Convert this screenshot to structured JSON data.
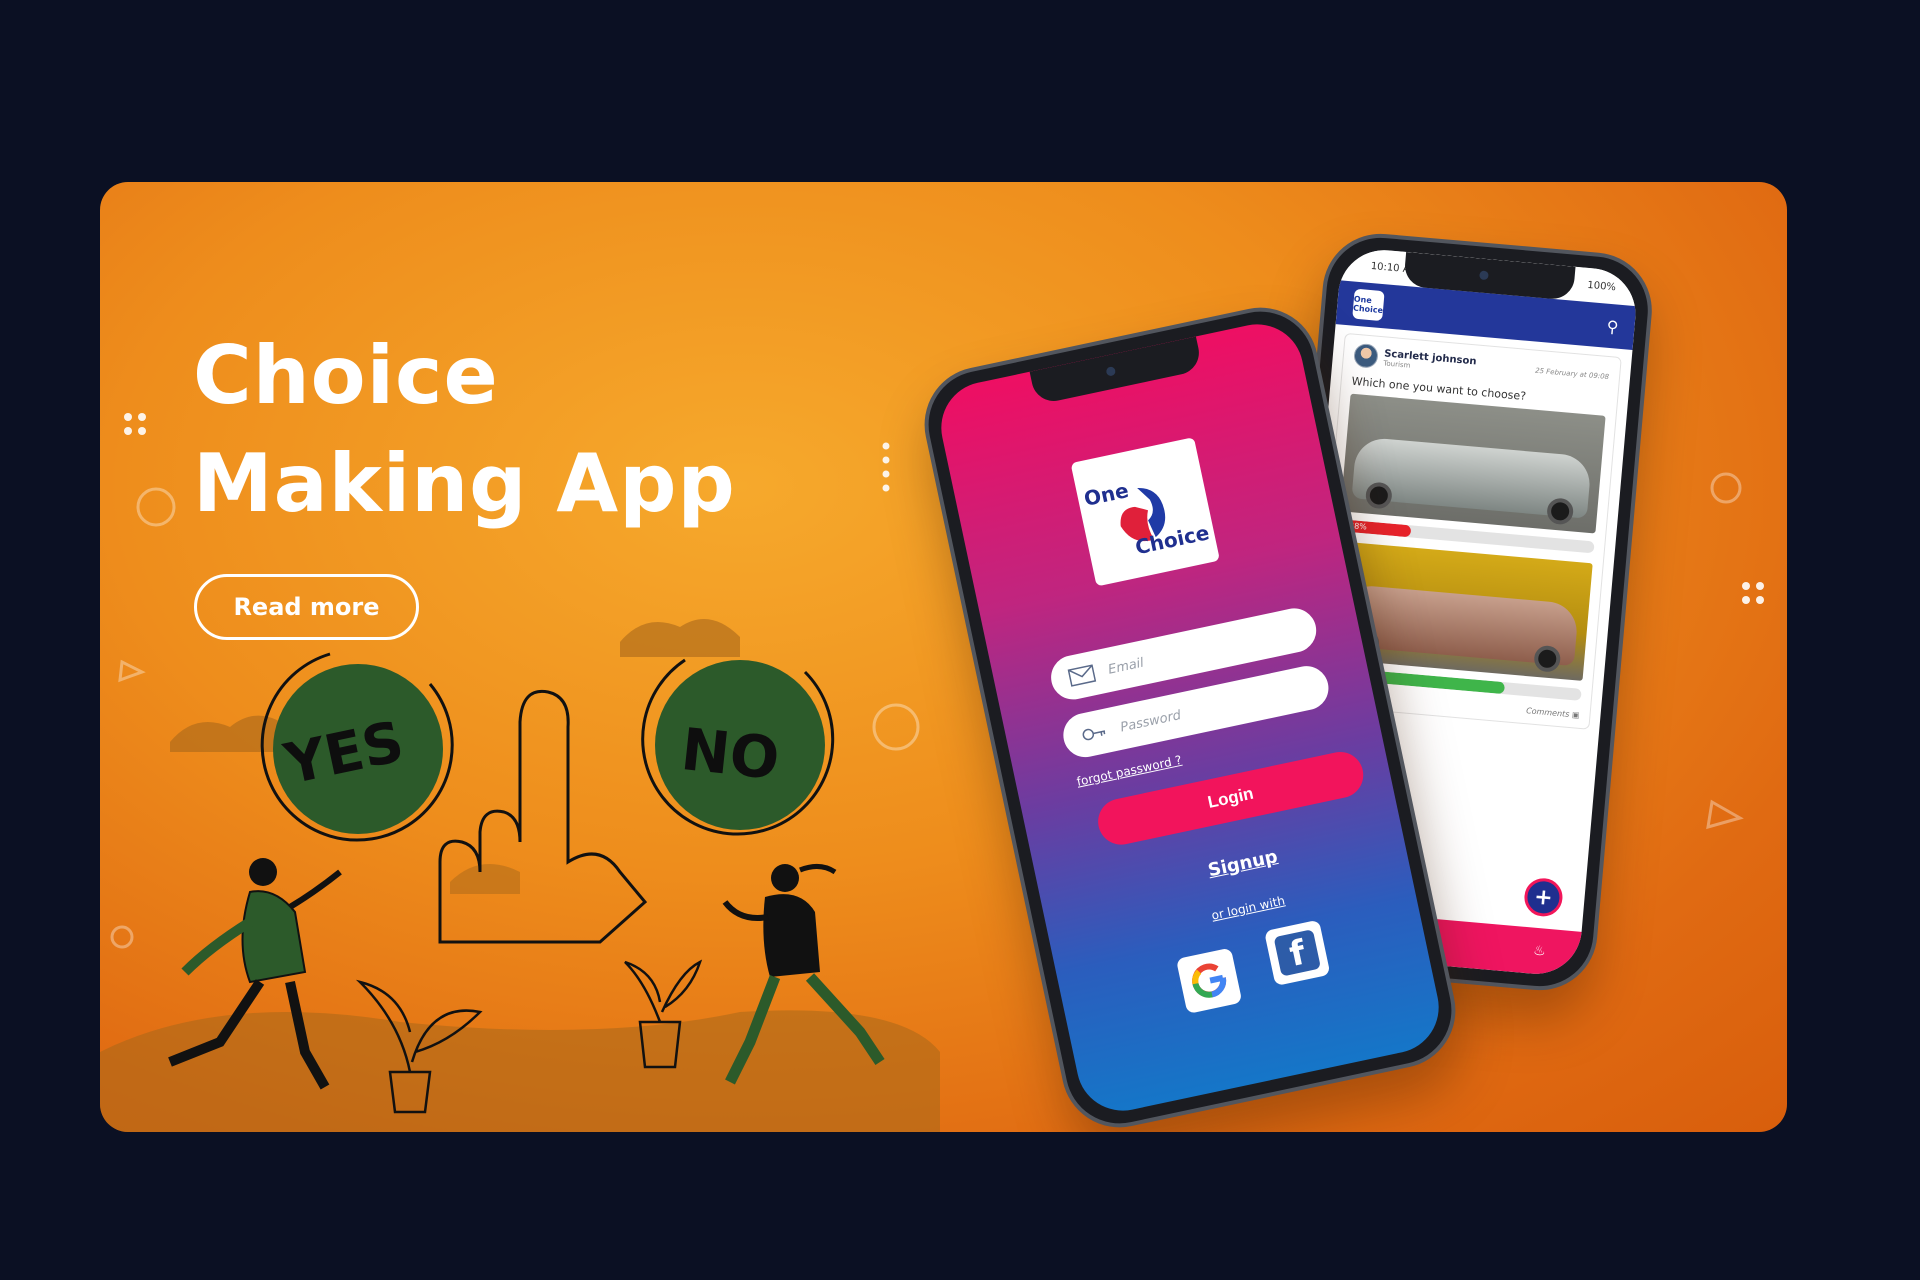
{
  "hero": {
    "title_line1": "Choice",
    "title_line2": "Making App",
    "read_more": "Read more"
  },
  "illustration": {
    "yes_label": "YES",
    "no_label": "NO"
  },
  "login_phone": {
    "logo_word_top": "One",
    "logo_word_bottom": "Choice",
    "email_placeholder": "Email",
    "password_placeholder": "Password",
    "forgot_password": "forgot password ?",
    "login_button": "Login",
    "signup_link": "Signup",
    "or_login_with": "or login with",
    "google_letter": "G",
    "facebook_letter": "f"
  },
  "feed_phone": {
    "status_time": "10:10 AM",
    "status_battery": "100%",
    "logo_text": "One Choice",
    "author_name": "Scarlett johnson",
    "author_role": "Tourism",
    "post_date": "25 February at 09:08",
    "question": "Which one you want to choose?",
    "option1_percent_label": "28%",
    "option1_percent": 28,
    "option2_percent": 70,
    "comments_label": "Comments",
    "fab_label": "+"
  },
  "colors": {
    "page_background": "#0b1023",
    "banner_orange": "#ee8d1c",
    "brand_pink": "#f2145c",
    "brand_blue": "#23379a",
    "illustration_green": "#2c5a2a",
    "vote_red": "#e8232b",
    "vote_green": "#3fb54a"
  }
}
